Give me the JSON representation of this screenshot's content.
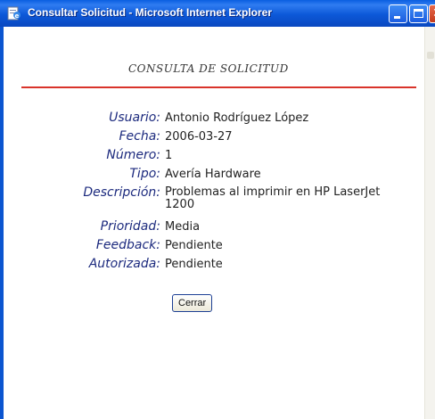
{
  "window": {
    "title": "Consultar Solicitud - Microsoft Internet Explorer"
  },
  "page": {
    "heading": "CONSULTA DE SOLICITUD",
    "rule_color": "#d9342b",
    "label_color": "#1c2a7e"
  },
  "fields": [
    {
      "label": "Usuario:",
      "value": "Antonio Rodríguez López"
    },
    {
      "label": "Fecha:",
      "value": "2006-03-27"
    },
    {
      "label": "Número:",
      "value": "1"
    },
    {
      "label": "Tipo:",
      "value": "Avería Hardware"
    },
    {
      "label": "Descripción:",
      "value": "Problemas al imprimir en HP LaserJet 1200"
    },
    {
      "label": "Prioridad:",
      "value": "Media"
    },
    {
      "label": "Feedback:",
      "value": "Pendiente"
    },
    {
      "label": "Autorizada:",
      "value": "Pendiente"
    }
  ],
  "actions": {
    "close_label": "Cerrar"
  },
  "icons": {
    "app": "ie-page-icon",
    "minimize": "minimize-icon",
    "maximize": "maximize-icon",
    "close": "close-icon"
  }
}
